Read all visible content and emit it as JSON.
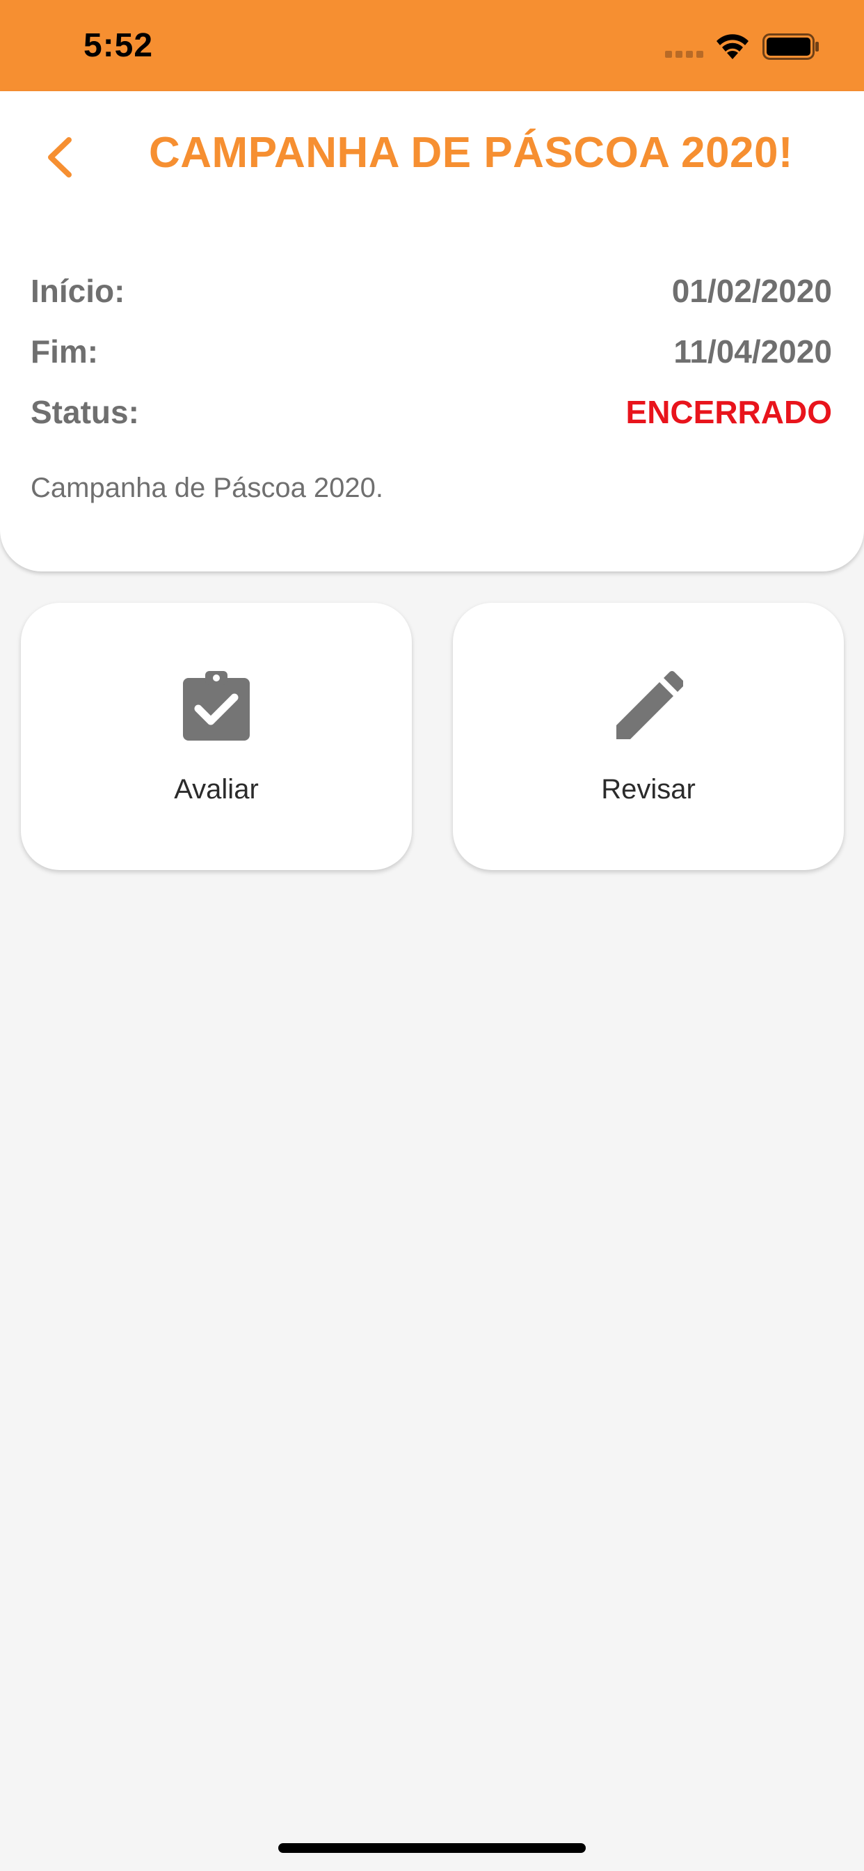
{
  "status_bar": {
    "time": "5:52",
    "background_color": "#f68f31"
  },
  "header": {
    "back_icon": "chevron-left-icon",
    "title": "CAMPANHA DE PÁSCOA 2020!",
    "accent_color": "#f68f31"
  },
  "details": {
    "start_label": "Início:",
    "start_value": "01/02/2020",
    "end_label": "Fim:",
    "end_value": "11/04/2020",
    "status_label": "Status:",
    "status_value": "ENCERRADO",
    "status_color": "#e8141c",
    "description": "Campanha de Páscoa 2020."
  },
  "actions": [
    {
      "label": "Avaliar",
      "icon": "clipboard-check-icon"
    },
    {
      "label": "Revisar",
      "icon": "pencil-icon"
    }
  ]
}
